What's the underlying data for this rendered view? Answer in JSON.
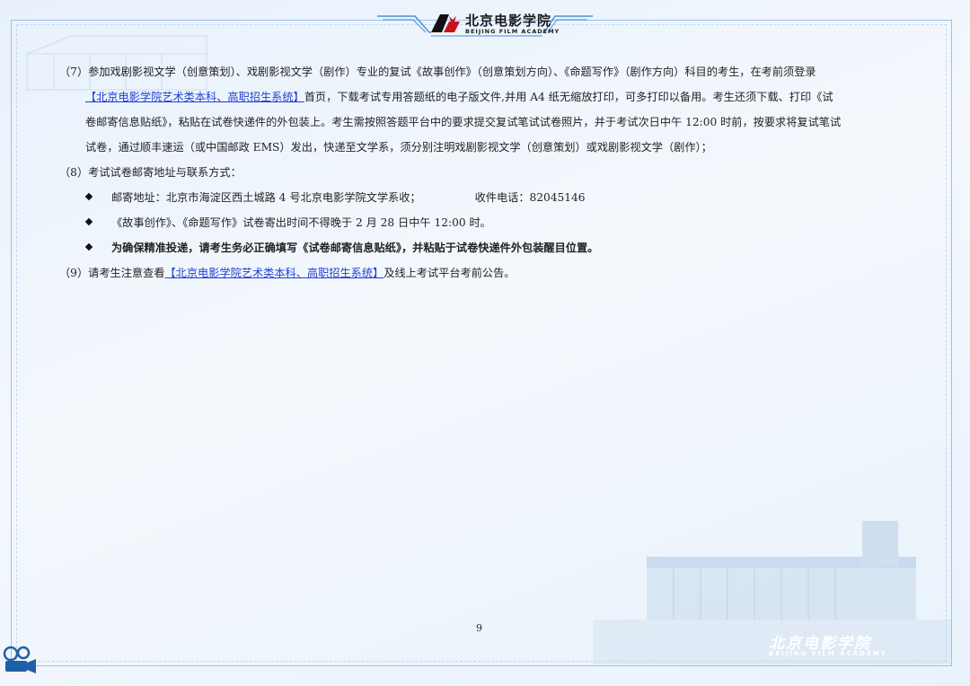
{
  "header": {
    "logo_cn": "北京电影学院",
    "logo_en": "BEIJING FILM ACADEMY"
  },
  "content": {
    "p7_a": "（7）参加戏剧影视文学（创意策划）、戏剧影视文学（剧作）专业的复试《故事创作》（创意策划方向）、《命题写作》（剧作方向）科目的考生，在考前须登录",
    "p7_link": "【北京电影学院艺术类本科、高职招生系统】",
    "p7_b": "首页，下载考试专用答题纸的电子版文件,并用 A4 纸无缩放打印，可多打印以备用。考生还须下载、打印《试",
    "p7_c": "卷邮寄信息贴纸》，粘贴在试卷快递件的外包装上。考生需按照答题平台中的要求提交复试笔试试卷照片，并于考试次日中午 12:00 时前，按要求将复试笔试",
    "p7_d": "试卷，通过顺丰速运（或中国邮政 EMS）发出，快递至文学系，须分别注明戏剧影视文学（创意策划）或戏剧影视文学（剧作）；",
    "p8": "（8）考试试卷邮寄地址与联系方式：",
    "bullet1_address": "邮寄地址：北京市海淀区西土城路 4 号北京电影学院文学系收；",
    "bullet1_phone": "收件电话：82045146",
    "bullet2": "《故事创作》、《命题写作》试卷寄出时间不得晚于 2 月 28 日中午 12:00 时。",
    "bullet3": "为确保精准投递，请考生务必正确填写《试卷邮寄信息贴纸》，并粘贴于试卷快递件外包装醒目位置。",
    "p9_a": "（9）请考生注意查看",
    "p9_link": "【北京电影学院艺术类本科、高职招生系统】",
    "p9_b": "及线上考试平台考前公告。"
  },
  "footer": {
    "page_number": "9",
    "watermark_cn": "北京电影学院",
    "watermark_en": "BEIJING FILM ACADEMY"
  },
  "colors": {
    "link": "#1f3fd6",
    "frame": "#9cc0e6",
    "background": "#eef4fb"
  }
}
